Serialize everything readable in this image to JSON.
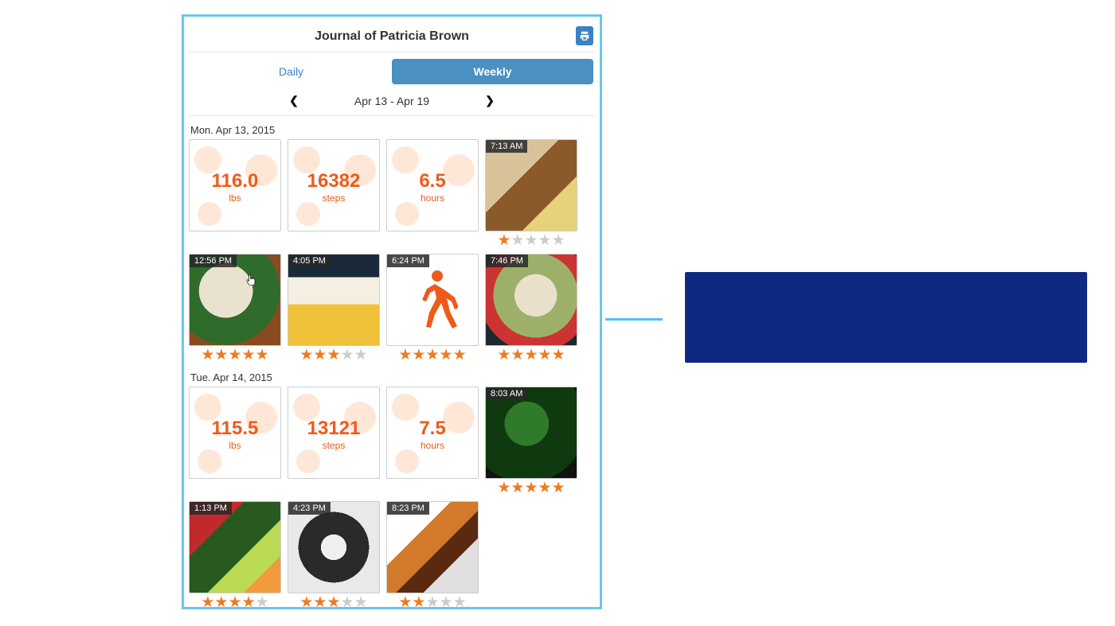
{
  "header": {
    "title": "Journal of Patricia Brown"
  },
  "tabs": {
    "daily": "Daily",
    "weekly": "Weekly",
    "active": "weekly"
  },
  "dateNav": {
    "range": "Apr 13 - Apr 19"
  },
  "days": [
    {
      "label": "Mon. Apr 13, 2015",
      "metrics": [
        {
          "value": "116.0",
          "unit": "lbs"
        },
        {
          "value": "16382",
          "unit": "steps"
        },
        {
          "value": "6.5",
          "unit": "hours"
        }
      ],
      "entries": [
        {
          "time": "7:13 AM",
          "type": "photo",
          "rating": 1,
          "imgClass": "g-a"
        },
        {
          "time": "12:56 PM",
          "type": "photo",
          "rating": 5,
          "imgClass": "g-b",
          "cursor": true
        },
        {
          "time": "4:05 PM",
          "type": "photo",
          "rating": 3,
          "imgClass": "g-c"
        },
        {
          "time": "6:24 PM",
          "type": "activity",
          "rating": 5
        },
        {
          "time": "7:46 PM",
          "type": "photo",
          "rating": 5,
          "imgClass": "g-d"
        }
      ]
    },
    {
      "label": "Tue. Apr 14, 2015",
      "metrics": [
        {
          "value": "115.5",
          "unit": "lbs"
        },
        {
          "value": "13121",
          "unit": "steps"
        },
        {
          "value": "7.5",
          "unit": "hours"
        }
      ],
      "entries": [
        {
          "time": "8:03 AM",
          "type": "photo",
          "rating": 5,
          "imgClass": "g-e"
        },
        {
          "time": "1:13 PM",
          "type": "photo",
          "rating": 4,
          "imgClass": "g-f"
        },
        {
          "time": "4:23 PM",
          "type": "photo",
          "rating": 3,
          "imgClass": "g-g"
        },
        {
          "time": "8:23 PM",
          "type": "photo",
          "rating": 2,
          "imgClass": "g-h"
        }
      ]
    }
  ],
  "colors": {
    "accent": "#ee5a1a",
    "tabActive": "#4a90c2",
    "frame": "#6ac7ea",
    "callout": "#0e2a80"
  }
}
